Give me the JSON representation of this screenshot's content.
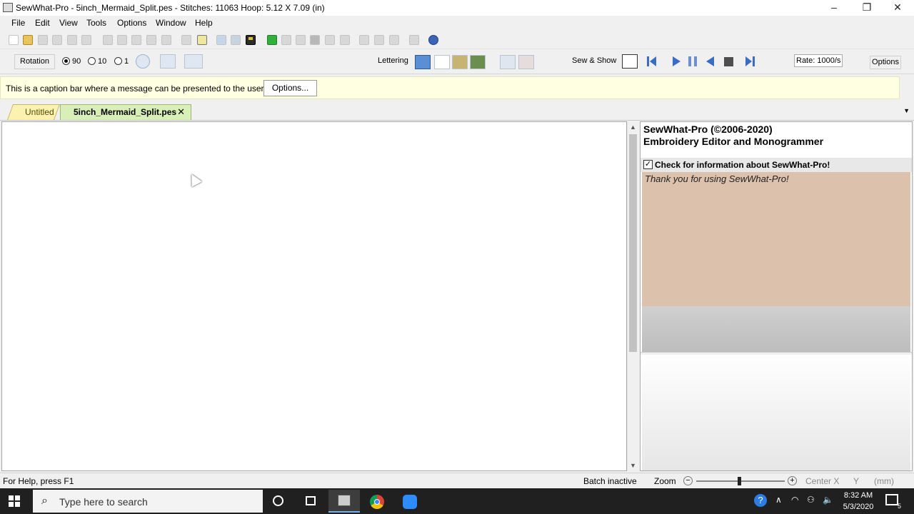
{
  "window": {
    "title": "SewWhat-Pro - 5inch_Mermaid_Split.pes - Stitches: 11063  Hoop: 5.12 X 7.09 (in)",
    "minimize": "–",
    "restore": "❐",
    "close": "✕"
  },
  "menu": {
    "items": [
      "File",
      "Edit",
      "View",
      "Tools",
      "Options",
      "Window",
      "Help"
    ]
  },
  "toolbar2": {
    "rotation_label": "Rotation",
    "radio_90": "90",
    "radio_10": "10",
    "radio_1": "1",
    "selected_rotation": "90",
    "lettering_label": "Lettering",
    "sew_show_label": "Sew & Show",
    "rate_value": "Rate: 1000/s",
    "options_label": "Options"
  },
  "caption": {
    "message": "This is a caption bar where a message can be presented to the user.",
    "options_button": "Options..."
  },
  "tabs": [
    {
      "label": "Untitled",
      "active": false
    },
    {
      "label": "5inch_Mermaid_Split.pes",
      "active": true
    }
  ],
  "tab_close": "✕",
  "tab_menu_arrow": "▼",
  "info_panel": {
    "title_line1": "SewWhat-Pro (©2006-2020)",
    "title_line2": "Embroidery Editor and Monogrammer",
    "check_label": "Check for information about SewWhat-Pro!",
    "checked": true,
    "thanks": "Thank you for using SewWhat-Pro!"
  },
  "status": {
    "help": "For Help, press F1",
    "batch": "Batch inactive",
    "zoom_label": "Zoom",
    "zoom_level_percent": 48,
    "center_x": "Center X",
    "y": "Y",
    "units": "(mm)"
  },
  "taskbar": {
    "search_placeholder": "Type here to search",
    "time": "8:32 AM",
    "date": "5/3/2020",
    "notification_count": "5",
    "pinned_apps": [
      "sewwhat-pro",
      "chrome",
      "zoom"
    ],
    "active_app": "sewwhat-pro"
  },
  "colors": {
    "caption_bg": "#ffffe1",
    "tab_untitled": "#fbf2b1",
    "tab_active": "#d9efb8",
    "info_panel_bg": "#dcc1ad",
    "taskbar": "#202020"
  }
}
